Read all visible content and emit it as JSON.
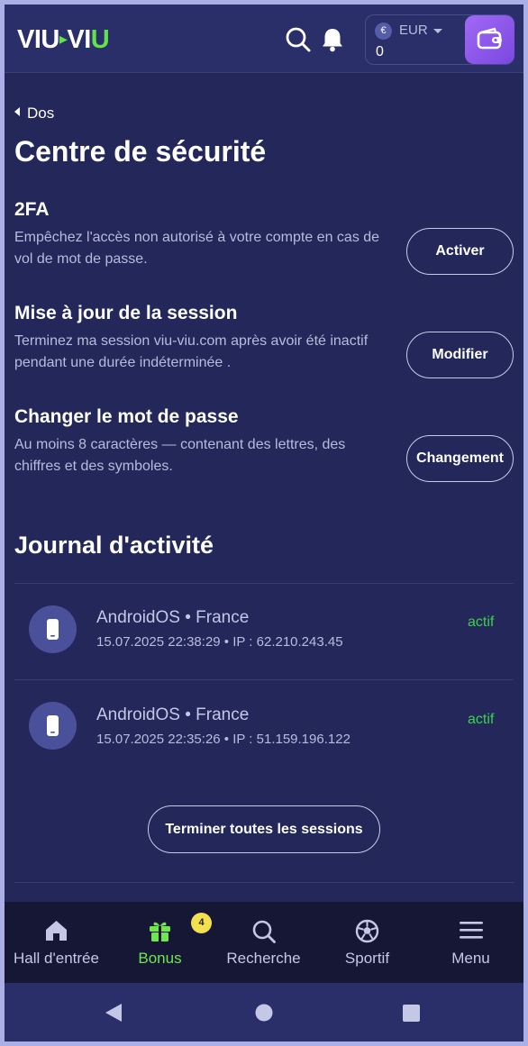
{
  "header": {
    "logo_left": "VIU",
    "logo_sep": "▸",
    "logo_right_1": "VI",
    "logo_right_2": "U",
    "currency_symbol": "€",
    "currency_code": "EUR",
    "balance": "0",
    "icons": [
      "search-icon",
      "bell-icon",
      "wallet-icon"
    ]
  },
  "back_label": "Dos",
  "page_title": "Centre de sécurité",
  "settings": [
    {
      "title": "2FA",
      "description": "Empêchez l'accès non autorisé à votre compte en cas de vol de mot de passe.",
      "button": "Activer"
    },
    {
      "title": "Mise à jour de la session",
      "description": "Terminez ma session viu-viu.com après avoir été inactif pendant une durée indéterminée .",
      "button": "Modifier"
    },
    {
      "title": "Changer le mot de passe",
      "description": "Au moins 8 caractères — contenant des lettres, des chiffres et des symboles.",
      "button": "Changement"
    }
  ],
  "journal": {
    "title": "Journal d'activité",
    "sessions": [
      {
        "os": "AndroidOS",
        "country": "France",
        "datetime": "15.07.2025 22:38:29",
        "ip": "IP : 62.210.243.45",
        "status": "actif"
      },
      {
        "os": "AndroidOS",
        "country": "France",
        "datetime": "15.07.2025 22:35:26",
        "ip": "IP : 51.159.196.122",
        "status": "actif"
      }
    ],
    "end_all_label": "Terminer toutes les sessions"
  },
  "bottom_nav": {
    "items": [
      {
        "label": "Hall d'entrée",
        "icon": "home-icon"
      },
      {
        "label": "Bonus",
        "icon": "gift-icon",
        "badge": "4"
      },
      {
        "label": "Recherche",
        "icon": "search-icon"
      },
      {
        "label": "Sportif",
        "icon": "soccer-ball-icon"
      },
      {
        "label": "Menu",
        "icon": "hamburger-menu-icon"
      }
    ],
    "active_color": "#6fe54f"
  },
  "system_nav": [
    "back-triangle-icon",
    "home-circle-icon",
    "recents-square-icon"
  ],
  "colors": {
    "background": "#23275a",
    "header": "#2a2f6a",
    "accent_green": "#5fe24a",
    "wallet_purple": "#9a62f0",
    "status_green": "#3ed14a"
  }
}
